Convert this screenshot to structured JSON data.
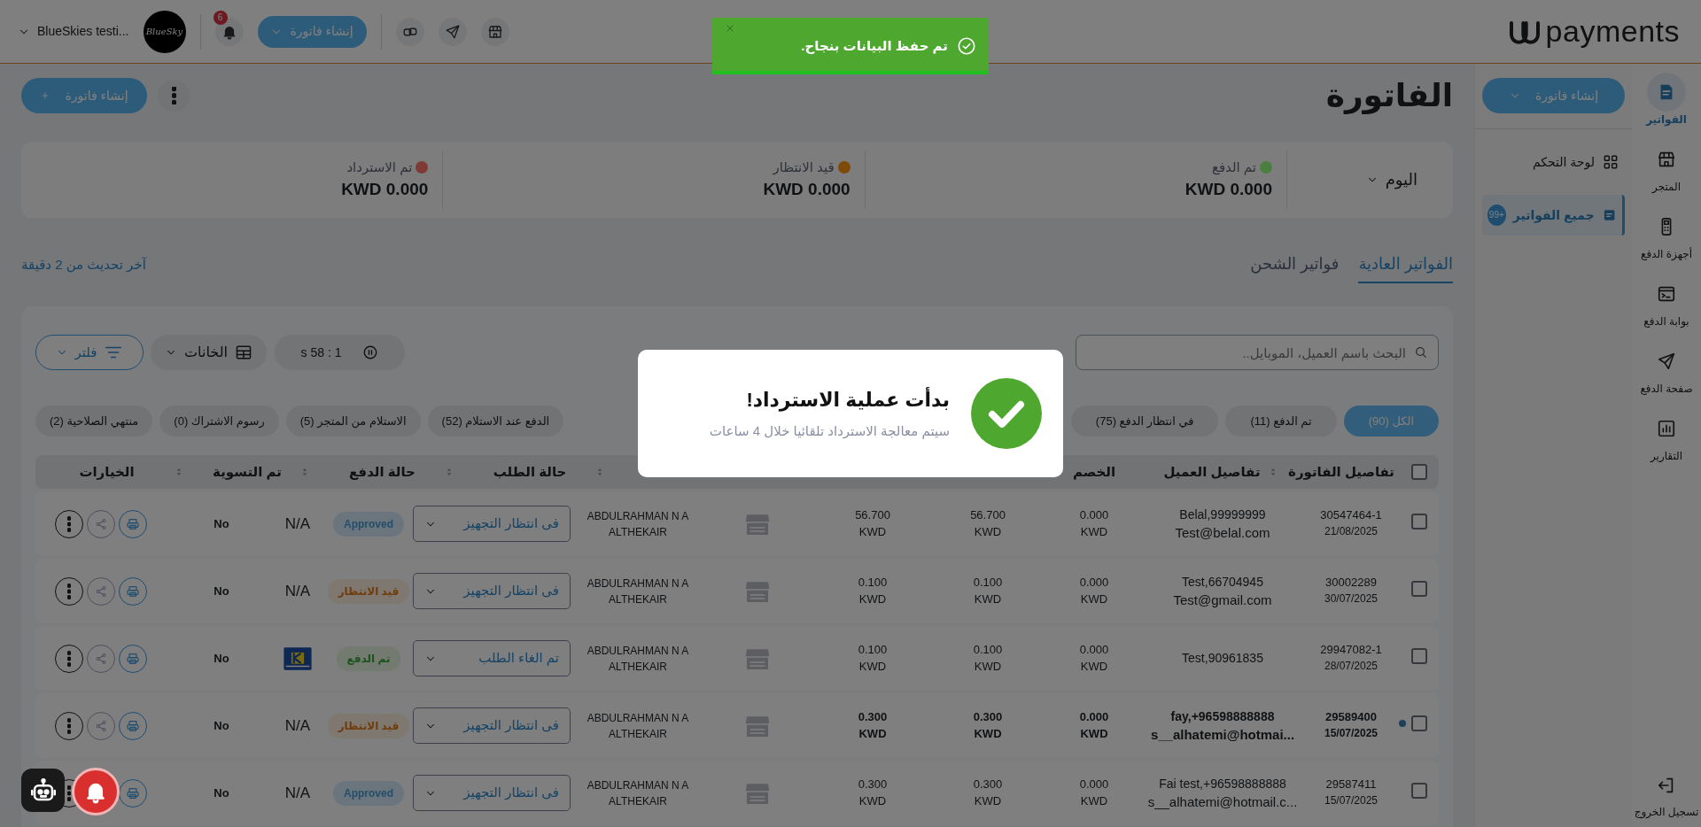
{
  "topbar": {
    "logo": "payments",
    "account_name": "BlueSkies testi...",
    "avatar_text": "BlueSky",
    "notification_count": "6",
    "create_button": "إنشاء فاتورة"
  },
  "rail": {
    "items": [
      {
        "kind": "invoice",
        "label": "الفواتير",
        "selected": true
      },
      {
        "kind": "store",
        "label": "المتجر",
        "selected": false
      },
      {
        "kind": "pos",
        "label": "أجهزة الدفع",
        "selected": false
      },
      {
        "kind": "gateway",
        "label": "بوابة الدفع",
        "selected": false
      },
      {
        "kind": "send",
        "label": "صفحة الدفع",
        "selected": false
      },
      {
        "kind": "chart",
        "label": "التقارير",
        "selected": false
      }
    ],
    "logout": "تسجيل الخروج"
  },
  "submenu": {
    "create_button": "إنشاء فاتورة",
    "items": [
      {
        "kind": "dashboard",
        "label": "لوحة التحكم",
        "selected": false
      },
      {
        "kind": "invoices",
        "label": "جميع الفواتير",
        "selected": true,
        "badge": "+99"
      }
    ]
  },
  "page": {
    "title": "الفاتورة",
    "create_button": "إنشاء فاتورة",
    "period": "اليوم",
    "stats": [
      {
        "label": "تم الدفع",
        "amount": "KWD 0.000",
        "color": "#4a7f40"
      },
      {
        "label": "قيد الانتظار",
        "amount": "KWD 0.000",
        "color": "#7f4a08"
      },
      {
        "label": "تم الاسترداد",
        "amount": "KWD 0.000",
        "color": "#7f3a33"
      }
    ]
  },
  "tabs": [
    {
      "label": "الفواتير العادية",
      "selected": true
    },
    {
      "label": "فواتير الشحن",
      "selected": false
    }
  ],
  "last_updated": "آخر تحديث من 2 دقيقة",
  "toolbar": {
    "search_placeholder": "البحث باسم العميل، الموبايل..",
    "timer": "s 58 : 1",
    "columns_button": "الخانات",
    "filter_button": "فلتر"
  },
  "chips": [
    {
      "label": "الكل (90)",
      "selected": true
    },
    {
      "label": "تم الدفع (11)",
      "selected": false
    },
    {
      "label": "في انتظار الدفع (75)",
      "selected": false
    },
    {
      "label": "الدفع عند الاستلام (52)",
      "selected": false
    },
    {
      "label": "الاستلام من المتجر (5)",
      "selected": false
    },
    {
      "label": "رسوم الاشتراك (0)",
      "selected": false
    },
    {
      "label": "منتهي الصلاحية (2)",
      "selected": false
    }
  ],
  "table": {
    "select_all": {
      "selected": false
    },
    "columns": [
      {
        "label": "تفاصيل الفاتورة",
        "sortable": false
      },
      {
        "label": "تفاصيل العميل",
        "sortable": true
      },
      {
        "label": "الخصم",
        "sortable": false
      },
      {
        "label": "حالة الطلب",
        "sortable": true
      },
      {
        "label": "حالة الدفع",
        "sortable": true
      },
      {
        "label": "تم التسوية",
        "sortable": true
      },
      {
        "label": "الخيارات",
        "sortable": true
      }
    ],
    "rows": [
      {
        "invoice": "30547464-1",
        "date": "21/08/2025",
        "customer": "Belal,99999999",
        "email": "Test@belal.com",
        "discount": {
          "value": "0.000",
          "currency": "KWD"
        },
        "amount_1": {
          "value": "56.700",
          "currency": "KWD"
        },
        "amount_2": {
          "value": "56.700",
          "currency": "KWD"
        },
        "employee": "ABDULRAHMAN N A ALTHEKAIR",
        "order_status": "فى انتظار التجهيز",
        "payment_status": {
          "kind": "approved",
          "label": "Approved"
        },
        "method": {
          "kind": "text",
          "label": "N/A"
        },
        "settled": "No",
        "unread": false,
        "selected": false
      },
      {
        "invoice": "30002289",
        "date": "30/07/2025",
        "customer": "Test,66704945",
        "email": "Test@gmail.com",
        "discount": {
          "value": "0.000",
          "currency": "KWD"
        },
        "amount_1": {
          "value": "0.100",
          "currency": "KWD"
        },
        "amount_2": {
          "value": "0.100",
          "currency": "KWD"
        },
        "employee": "ABDULRAHMAN N A ALTHEKAIR",
        "order_status": "فى انتظار التجهيز",
        "payment_status": {
          "kind": "pending",
          "label": "قيد الانتظار"
        },
        "method": {
          "kind": "text",
          "label": "N/A"
        },
        "settled": "No",
        "unread": false,
        "selected": false
      },
      {
        "invoice": "29947082-1",
        "date": "28/07/2025",
        "customer": "Test,90961835",
        "discount": {
          "value": "0.000",
          "currency": "KWD"
        },
        "amount_1": {
          "value": "0.100",
          "currency": "KWD"
        },
        "amount_2": {
          "value": "0.100",
          "currency": "KWD"
        },
        "employee": "ABDULRAHMAN N A ALTHEKAIR",
        "order_status": "تم الغاء الطلب",
        "payment_status": {
          "kind": "paid",
          "label": "تم الدفع"
        },
        "method": {
          "kind": "card"
        },
        "settled": "No",
        "unread": false,
        "selected": false
      },
      {
        "invoice": "29589400",
        "date": "15/07/2025",
        "customer": "fay,+96598888888",
        "email": "s__alhatemi@hotmai...",
        "discount": {
          "value": "0.000",
          "currency": "KWD"
        },
        "amount_1": {
          "value": "0.300",
          "currency": "KWD"
        },
        "amount_2": {
          "value": "0.300",
          "currency": "KWD"
        },
        "employee": "ABDULRAHMAN N A ALTHEKAIR",
        "order_status": "فى انتظار التجهيز",
        "payment_status": {
          "kind": "pending",
          "label": "قيد الانتظار"
        },
        "method": {
          "kind": "text",
          "label": "N/A"
        },
        "settled": "No",
        "unread": true,
        "selected": false
      },
      {
        "invoice": "29587411",
        "date": "15/07/2025",
        "customer": "Fai test,+96598888888",
        "email": "s__alhatemi@hotmail.c...",
        "discount": {
          "value": "0.000",
          "currency": "KWD"
        },
        "amount_1": {
          "value": "0.300",
          "currency": "KWD"
        },
        "amount_2": {
          "value": "0.300",
          "currency": "KWD"
        },
        "employee": "ABDULRAHMAN N A ALTHEKAIR",
        "order_status": "فى انتظار التجهيز",
        "payment_status": {
          "kind": "approved",
          "label": "Approved"
        },
        "method": {
          "kind": "text",
          "label": "N/A"
        },
        "settled": "No",
        "unread": false,
        "selected": false
      }
    ]
  },
  "modal": {
    "title": "بدأت عملية الاسترداد!",
    "message": "سيتم معالجة الاسترداد تلقائيا خلال 4 ساعات"
  },
  "toast": {
    "message": "تم حفظ البيانات بنجاح.",
    "level": 1
  }
}
